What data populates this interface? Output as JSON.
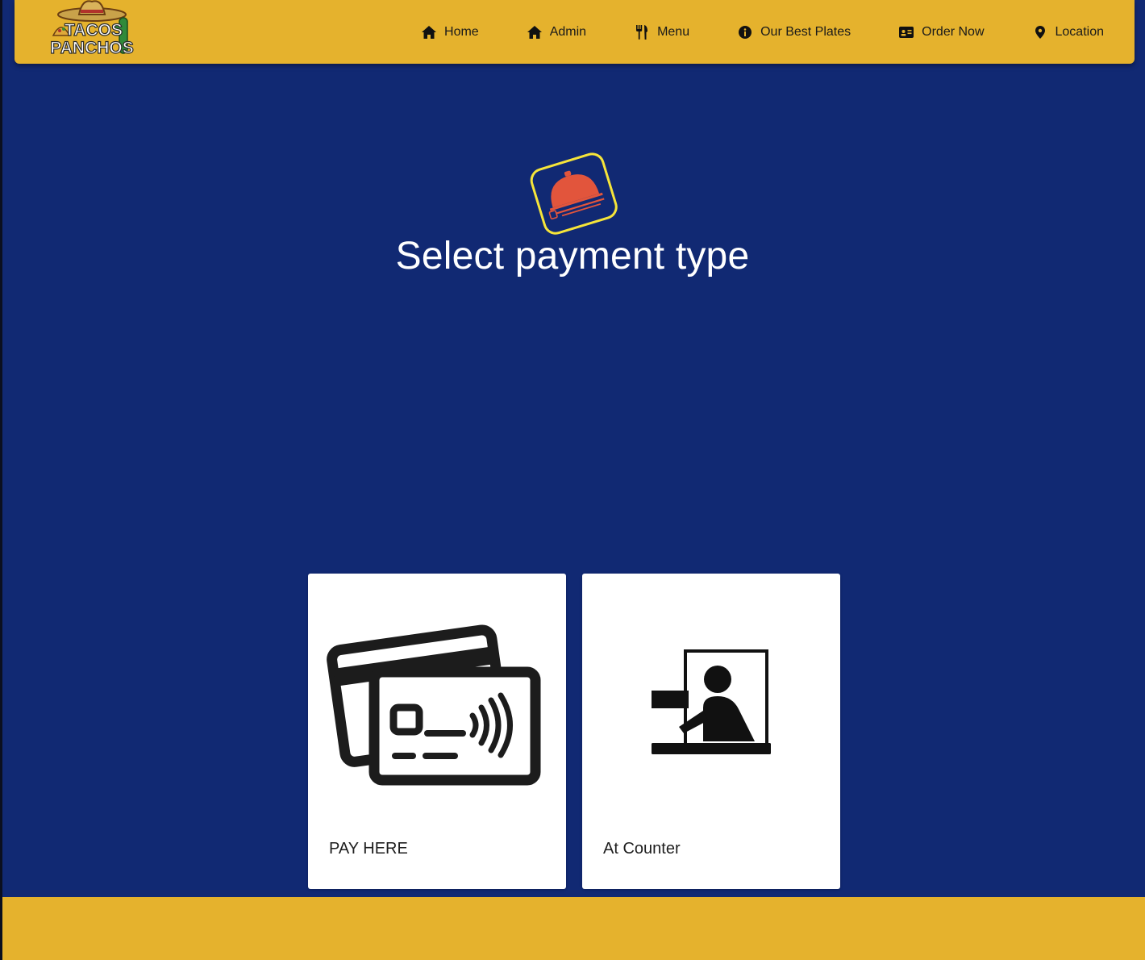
{
  "header": {
    "logo_text_top": "TACOS",
    "logo_text_bottom": "PANCHOS",
    "nav": [
      {
        "label": "Home",
        "icon": "home-icon"
      },
      {
        "label": "Admin",
        "icon": "home-icon"
      },
      {
        "label": "Menu",
        "icon": "utensils-icon"
      },
      {
        "label": "Our Best Plates",
        "icon": "info-circle-icon"
      },
      {
        "label": "Order Now",
        "icon": "id-card-icon"
      },
      {
        "label": "Location",
        "icon": "map-pin-icon"
      }
    ]
  },
  "main": {
    "title": "Select payment type",
    "hero_icon": "serving-cloche-icon",
    "options": [
      {
        "label": "PAY HERE",
        "icon": "contactless-cards-icon"
      },
      {
        "label": "At Counter",
        "icon": "counter-cashier-icon"
      }
    ]
  },
  "colors": {
    "background": "#112973",
    "header": "#e5b22d",
    "footer": "#e5b22d",
    "card": "#ffffff",
    "cloche": "#e2553c",
    "hero_border": "#f6e53a"
  }
}
